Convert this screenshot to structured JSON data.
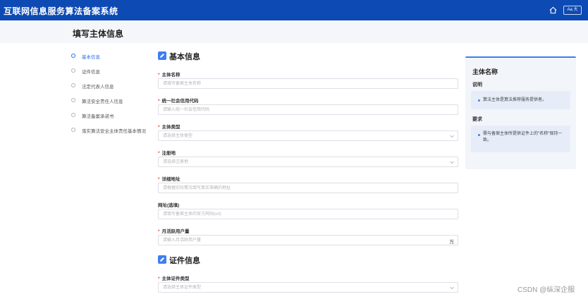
{
  "app": {
    "title": "互联网信息服务算法备案系统",
    "font_button": "Aa 大"
  },
  "page": {
    "title": "填写主体信息"
  },
  "steps": [
    {
      "label": "基本信息",
      "active": true
    },
    {
      "label": "证件信息",
      "active": false
    },
    {
      "label": "法定代表人信息",
      "active": false
    },
    {
      "label": "算法安全责任人信息",
      "active": false
    },
    {
      "label": "算法备案承诺书",
      "active": false
    },
    {
      "label": "落实算法安全主体责任基本情况",
      "active": false
    }
  ],
  "sections": {
    "basic": "基本信息",
    "cert": "证件信息"
  },
  "fields": {
    "name": {
      "label": "主体名称",
      "placeholder": "请填写备案主体名称"
    },
    "credit_code": {
      "label": "统一社会信用代码",
      "placeholder": "请输入统一社会信用代码"
    },
    "type": {
      "label": "主体类型",
      "placeholder": "请选择主体类型"
    },
    "reg_place": {
      "label": "注册地",
      "placeholder": "请选择注册地"
    },
    "address": {
      "label": "详细地址",
      "placeholder": "请根据实际情况填写真实准确的地址"
    },
    "website": {
      "label": "网址(选填)",
      "placeholder": "请填写备案主体的官方网站(url)"
    },
    "mau": {
      "label": "月活跃用户量",
      "placeholder": "请输入月活跃用户量",
      "unit": "万"
    },
    "cert_type": {
      "label": "主体证件类型",
      "placeholder": "请选择主体证件类型"
    }
  },
  "help": {
    "title": "主体名称",
    "desc_heading": "说明",
    "desc_text": "算法主体是算法推荐服务提供者。",
    "req_heading": "要求",
    "req_text": "需与备案主体所提供证件上的\"名称\"保持一致。"
  },
  "watermark": "CSDN @纵深企服",
  "colors": {
    "topbar": "#0e4ab3",
    "accent": "#3d7ff0",
    "required": "#e8473b"
  }
}
